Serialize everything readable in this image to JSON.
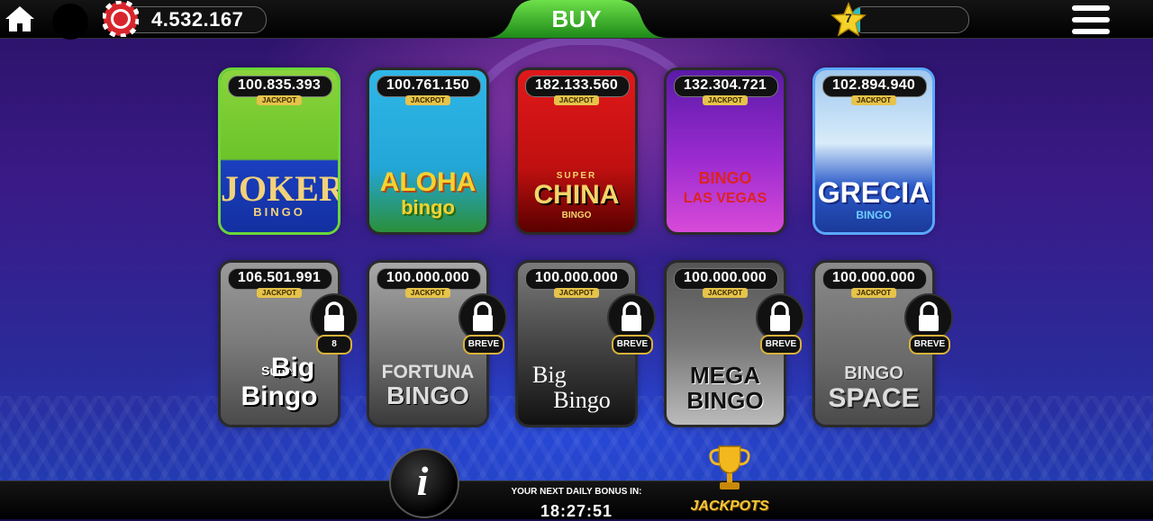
{
  "topbar": {
    "coins": "4.532.167",
    "buy_label": "BUY",
    "level": "7",
    "xp_fraction": 0.08,
    "icons": {
      "home": "home-icon",
      "chip": "casino-chip-icon",
      "star": "star-icon",
      "menu": "hamburger-menu-icon"
    }
  },
  "games": [
    {
      "jackpot": "100.835.393",
      "tag": "JACKPOT",
      "title": "JOKER",
      "subtitle": "BINGO",
      "locked": false
    },
    {
      "jackpot": "100.761.150",
      "tag": "JACKPOT",
      "title": "ALOHA",
      "subtitle": "bingo",
      "locked": false
    },
    {
      "jackpot": "182.133.560",
      "tag": "JACKPOT",
      "title": "CHINA",
      "subtitle": "BINGO",
      "super": "SUPER",
      "locked": false
    },
    {
      "jackpot": "132.304.721",
      "tag": "JACKPOT",
      "title": "LAS VEGAS",
      "subtitle": "BINGO",
      "locked": false
    },
    {
      "jackpot": "102.894.940",
      "tag": "JACKPOT",
      "title": "GRECIA",
      "subtitle": "BINGO",
      "locked": false
    },
    {
      "jackpot": "106.501.991",
      "tag": "JACKPOT",
      "title": "Big",
      "subtitle": "Bingo",
      "super": "Super",
      "locked": true,
      "lock_label": "8"
    },
    {
      "jackpot": "100.000.000",
      "tag": "JACKPOT",
      "title": "FORTUNA",
      "subtitle": "BINGO",
      "locked": true,
      "lock_label": "BREVE"
    },
    {
      "jackpot": "100.000.000",
      "tag": "JACKPOT",
      "title": "Big",
      "subtitle": "Bingo",
      "locked": true,
      "lock_label": "BREVE"
    },
    {
      "jackpot": "100.000.000",
      "tag": "JACKPOT",
      "title": "MEGA",
      "subtitle": "BINGO",
      "locked": true,
      "lock_label": "BREVE"
    },
    {
      "jackpot": "100.000.000",
      "tag": "JACKPOT",
      "title": "BINGO",
      "subtitle": "SPACE",
      "locked": true,
      "lock_label": "BREVE"
    }
  ],
  "bottombar": {
    "info_label": "i",
    "bonus_label": "YOUR NEXT DAILY BONUS IN:",
    "bonus_timer": "18:27:51",
    "jackpots_label": "JACKPOTS",
    "icons": {
      "info": "info-icon",
      "trophy": "trophy-icon",
      "lock": "lock-icon"
    }
  }
}
